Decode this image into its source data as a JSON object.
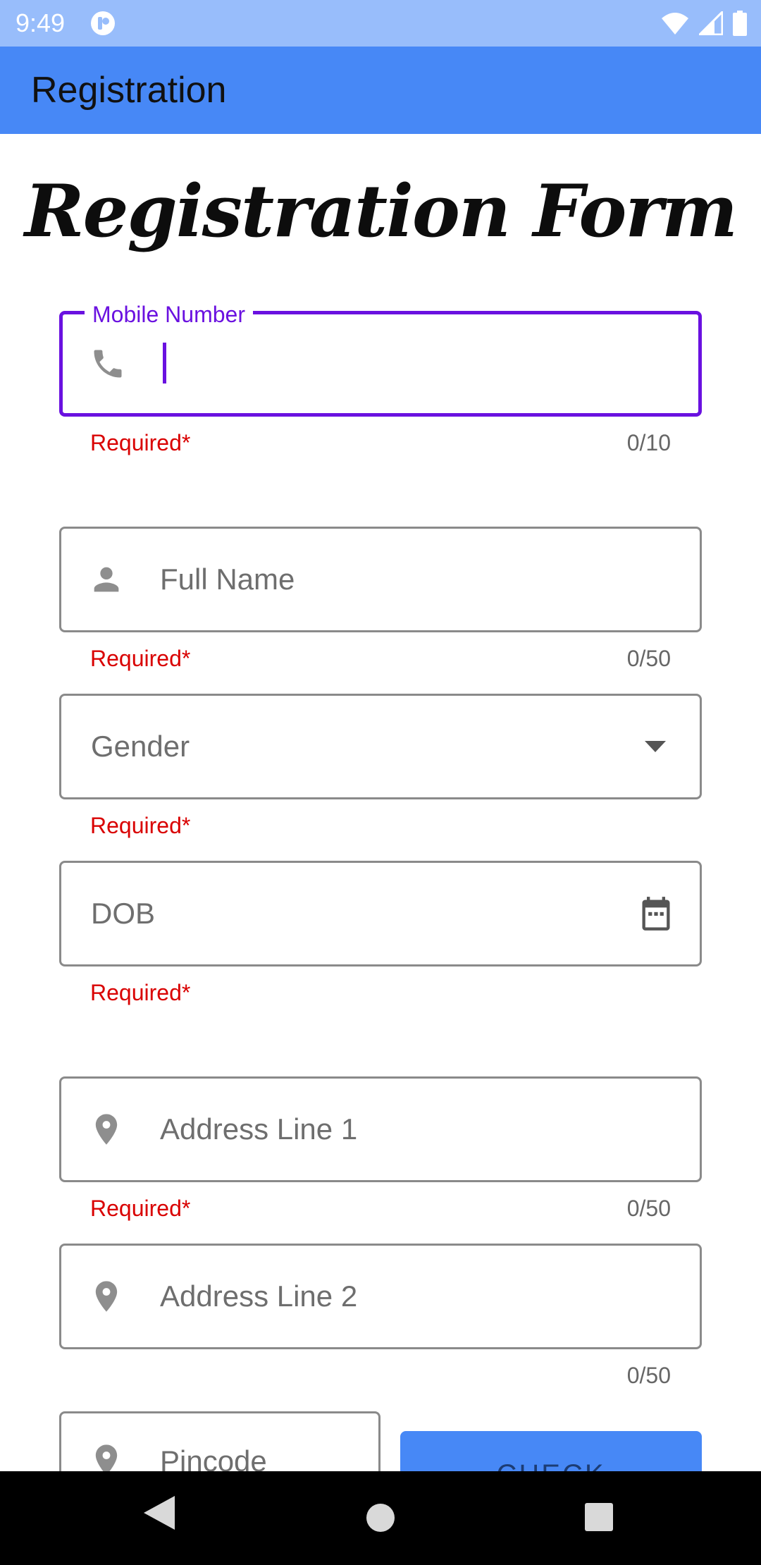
{
  "status": {
    "time": "9:49"
  },
  "app_bar": {
    "title": "Registration"
  },
  "form": {
    "title": "Registration Form",
    "mobile": {
      "label": "Mobile Number",
      "value": "",
      "helper": "Required*",
      "counter": "0/10"
    },
    "full_name": {
      "placeholder": "Full Name",
      "helper": "Required*",
      "counter": "0/50"
    },
    "gender": {
      "placeholder": "Gender",
      "helper": "Required*"
    },
    "dob": {
      "placeholder": "DOB",
      "helper": "Required*"
    },
    "address1": {
      "placeholder": "Address Line 1",
      "helper": "Required*",
      "counter": "0/50"
    },
    "address2": {
      "placeholder": "Address Line 2",
      "counter": "0/50"
    },
    "pincode": {
      "placeholder": "Pincode"
    },
    "check_label": "CHECK"
  },
  "colors": {
    "status_bar": "#98bdfb",
    "app_bar": "#4788f6",
    "focus": "#6a11e0",
    "error": "#d90000"
  }
}
